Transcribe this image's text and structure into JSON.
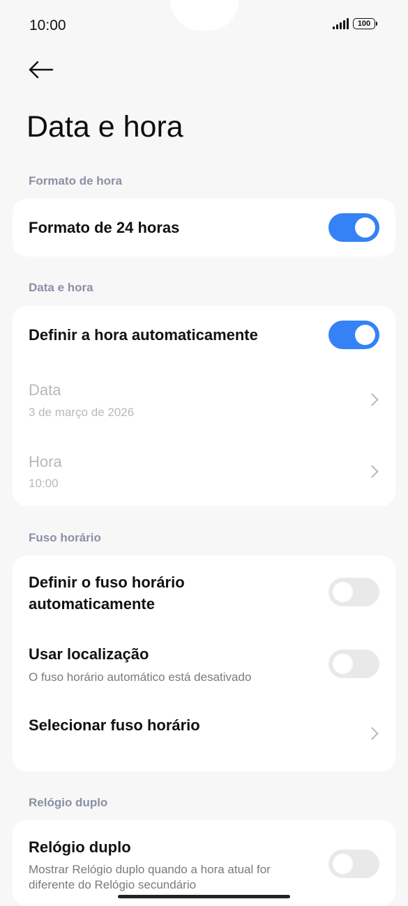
{
  "status": {
    "time": "10:00",
    "battery": "100"
  },
  "page": {
    "title": "Data e hora"
  },
  "sections": {
    "time_format": {
      "label": "Formato de hora"
    },
    "date_time": {
      "label": "Data e hora"
    },
    "timezone": {
      "label": "Fuso horário"
    },
    "dual_clock": {
      "label": "Relógio duplo"
    }
  },
  "settings": {
    "format24": {
      "title": "Formato de 24 horas",
      "enabled": true
    },
    "auto_time": {
      "title": "Definir a hora automaticamente",
      "enabled": true
    },
    "date": {
      "title": "Data",
      "value": "3 de março de 2026"
    },
    "hour": {
      "title": "Hora",
      "value": "10:00"
    },
    "auto_timezone": {
      "title_line1": "Definir o fuso horário",
      "title_line2": "automaticamente",
      "enabled": false
    },
    "use_location": {
      "title": "Usar localização",
      "subtitle": "O fuso horário automático está desativado",
      "enabled": false
    },
    "select_timezone": {
      "title": "Selecionar fuso horário"
    },
    "dual_clock": {
      "title": "Relógio duplo",
      "subtitle_line1": "Mostrar Relógio duplo quando a hora atual for",
      "subtitle_line2": "diferente do Relógio secundário",
      "enabled": false
    }
  },
  "colors": {
    "accent": "#3482f6",
    "section_label": "#8a8fa5",
    "background": "#f7f7f7"
  }
}
